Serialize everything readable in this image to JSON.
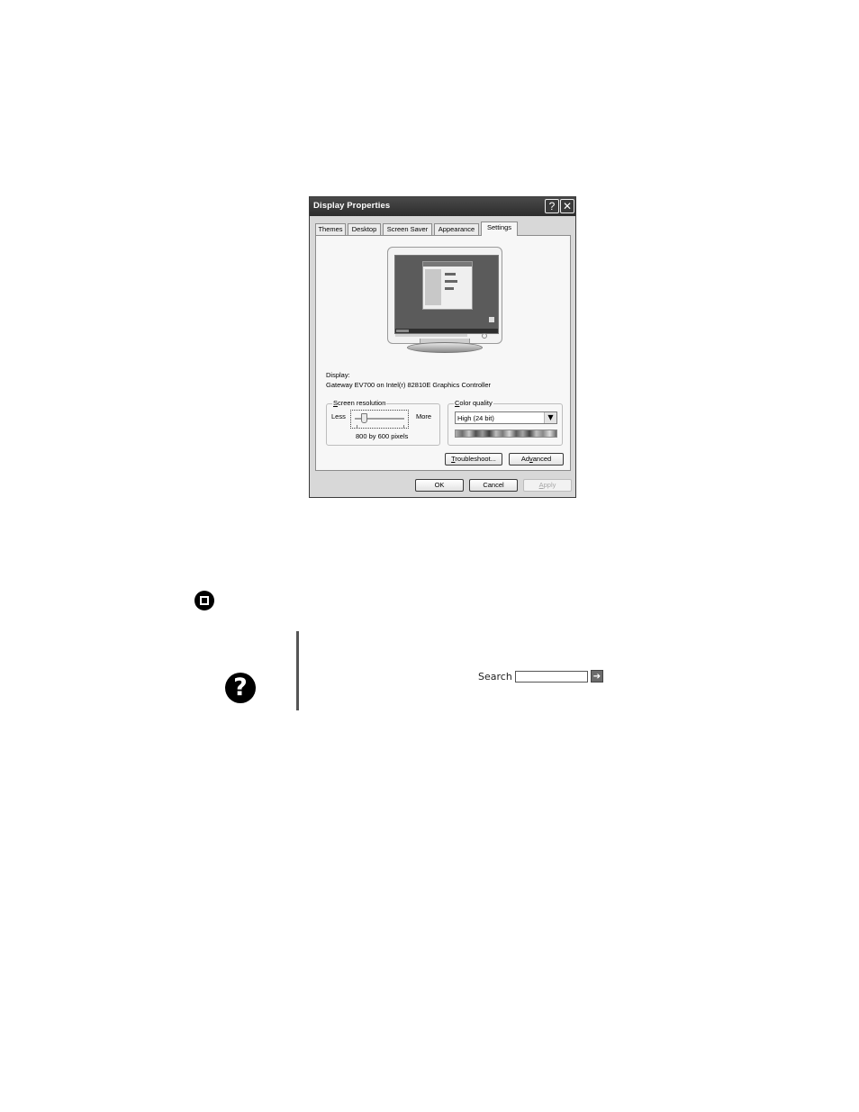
{
  "dialog": {
    "title": "Display Properties",
    "help_glyph": "?",
    "close_glyph": "✕",
    "tabs": [
      {
        "label": "Themes",
        "active": false
      },
      {
        "label": "Desktop",
        "active": false
      },
      {
        "label": "Screen Saver",
        "active": false
      },
      {
        "label": "Appearance",
        "active": false
      },
      {
        "label": "Settings",
        "active": true
      }
    ],
    "display_label": "Display:",
    "display_value": "Gateway EV700 on Intel(r) 82810E Graphics Controller",
    "screen_resolution": {
      "legend_pre": "",
      "legend_accel": "S",
      "legend_post": "creen resolution",
      "less_label": "Less",
      "more_label": "More",
      "value_text": "800 by 600 pixels",
      "slider_position": 0.15
    },
    "color_quality": {
      "legend_pre": "",
      "legend_accel": "C",
      "legend_post": "olor quality",
      "selected": "High (24 bit)"
    },
    "troubleshoot_button": {
      "accel": "T",
      "rest": "roubleshoot..."
    },
    "advanced_button": {
      "pre": "Ad",
      "accel": "v",
      "post": "anced"
    },
    "ok_button": "OK",
    "cancel_button": "Cancel",
    "apply_button": {
      "accel": "A",
      "rest": "pply"
    }
  },
  "page": {
    "search_label": "Search",
    "search_value": "",
    "go_glyph": "➔"
  },
  "icons": {
    "stop": "stop-icon",
    "help": "help-icon"
  },
  "colors": {
    "title_bar": "#2c2c2c",
    "panel": "#f7f7f7",
    "dialog_bg": "#d8d8d8"
  }
}
